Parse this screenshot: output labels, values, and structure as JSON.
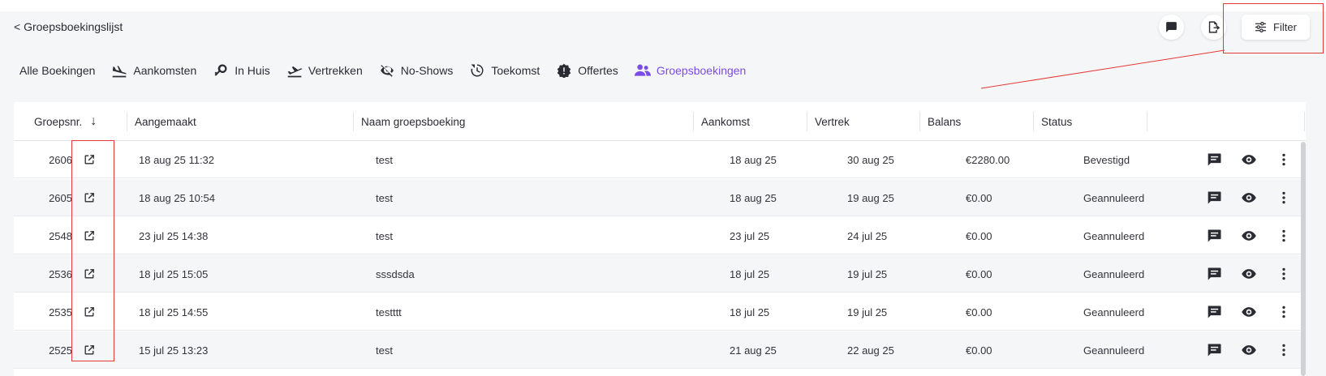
{
  "header": {
    "back_label": "< Groepsboekingslijst",
    "filter_label": "Filter",
    "chat_icon": "chat-icon",
    "export_icon": "export-icon",
    "filter_icon": "sliders-icon"
  },
  "tabs": [
    {
      "label": "Alle Boekingen",
      "icon": "",
      "active": false
    },
    {
      "label": "Aankomsten",
      "icon": "plane-landing-icon",
      "active": false
    },
    {
      "label": "In Huis",
      "icon": "key-icon",
      "active": false
    },
    {
      "label": "Vertrekken",
      "icon": "plane-departure-icon",
      "active": false
    },
    {
      "label": "No-Shows",
      "icon": "eye-off-icon",
      "active": false
    },
    {
      "label": "Toekomst",
      "icon": "clock-forward-icon",
      "active": false
    },
    {
      "label": "Offertes",
      "icon": "alert-badge-icon",
      "active": false
    },
    {
      "label": "Groepsboekingen",
      "icon": "group-icon",
      "active": true
    }
  ],
  "table": {
    "columns": [
      "Groepsnr.",
      "Aangemaakt",
      "Naam groepsboeking",
      "Aankomst",
      "Vertrek",
      "Balans",
      "Status"
    ],
    "sort_indicator": "↓",
    "rows": [
      {
        "nr": "2606",
        "created": "18 aug 25 11:32",
        "name": "test",
        "arrival": "18 aug 25",
        "departure": "30 aug 25",
        "balance": "€2280.00",
        "status": "Bevestigd"
      },
      {
        "nr": "2605",
        "created": "18 aug 25 10:54",
        "name": "test",
        "arrival": "18 aug 25",
        "departure": "19 aug 25",
        "balance": "€0.00",
        "status": "Geannuleerd"
      },
      {
        "nr": "2548",
        "created": "23 jul 25 14:38",
        "name": "test",
        "arrival": "23 jul 25",
        "departure": "24 jul 25",
        "balance": "€0.00",
        "status": "Geannuleerd"
      },
      {
        "nr": "2536",
        "created": "18 jul 25 15:05",
        "name": "sssdsda",
        "arrival": "18 jul 25",
        "departure": "19 jul 25",
        "balance": "€0.00",
        "status": "Geannuleerd"
      },
      {
        "nr": "2535",
        "created": "18 jul 25 14:55",
        "name": "testttt",
        "arrival": "18 jul 25",
        "departure": "19 jul 25",
        "balance": "€0.00",
        "status": "Geannuleerd"
      },
      {
        "nr": "2525",
        "created": "15 jul 25 13:23",
        "name": "test",
        "arrival": "21 aug 25",
        "departure": "22 aug 25",
        "balance": "€0.00",
        "status": "Geannuleerd"
      }
    ]
  },
  "colors": {
    "accent": "#7b4ce6",
    "annotation": "#e53935",
    "background": "#f5f6f8"
  }
}
